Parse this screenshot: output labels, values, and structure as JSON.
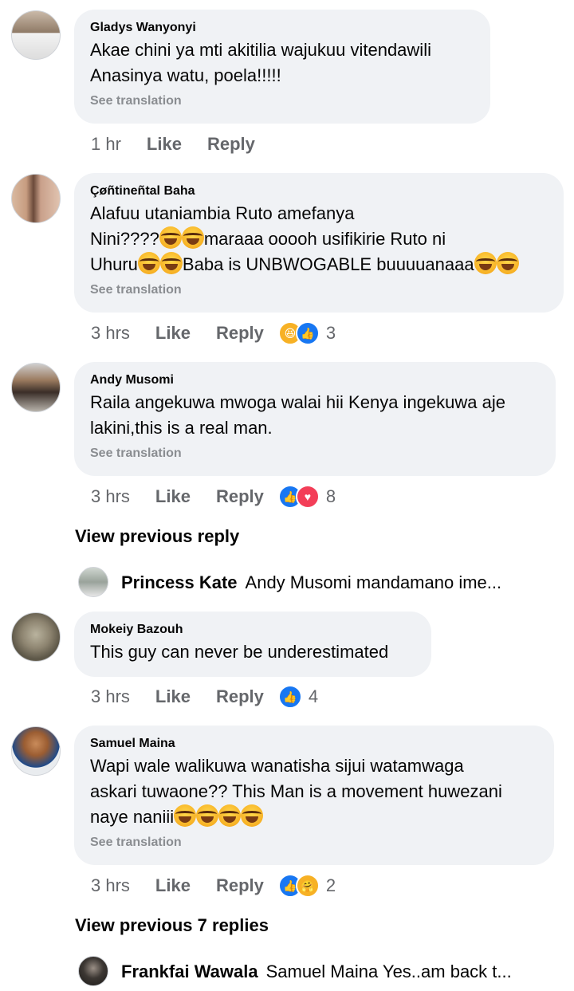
{
  "comments": [
    {
      "name": "Gladys Wanyonyi",
      "lines": [
        "Akae chini ya mti akitilia wajukuu vitendawili",
        "Anasinya watu, poela!!!!!"
      ],
      "see_translation": "See translation",
      "time": "1 hr",
      "like": "Like",
      "reply": "Reply"
    },
    {
      "name": "Çøñtineñtal Baha",
      "line1": "Alafuu utaniambia Ruto amefanya",
      "line2a": "Nini????",
      "line2b": "maraaa ooooh usifikirie Ruto ni",
      "line3a": "Uhuru",
      "line3b": "Baba is UNBWOGABLE buuuuanaaa",
      "see_translation": "See translation",
      "time": "3 hrs",
      "like": "Like",
      "reply": "Reply",
      "reaction_count": "3",
      "reactions": [
        "haha-icon",
        "like-icon"
      ]
    },
    {
      "name": "Andy Musomi",
      "lines": [
        "Raila angekuwa mwoga walai hii Kenya ingekuwa aje",
        "lakini,this is a real man."
      ],
      "see_translation": "See translation",
      "time": "3 hrs",
      "like": "Like",
      "reply": "Reply",
      "reaction_count": "8",
      "reactions": [
        "like-icon",
        "love-icon"
      ]
    },
    {
      "name": "Mokeiy Bazouh",
      "lines": [
        "This guy can never be underestimated"
      ],
      "time": "3 hrs",
      "like": "Like",
      "reply": "Reply",
      "reaction_count": "4",
      "reactions": [
        "like-icon"
      ]
    },
    {
      "name": "Samuel Maina",
      "line1": "Wapi wale walikuwa wanatisha sijui watamwaga",
      "line2": "askari tuwaone?? This Man is a movement huwezani",
      "line3": "naye naniii",
      "see_translation": "See translation",
      "time": "3 hrs",
      "like": "Like",
      "reply": "Reply",
      "reaction_count": "2",
      "reactions": [
        "like-icon",
        "care-icon"
      ]
    }
  ],
  "view_prev_1": "View previous reply",
  "reply_preview_1": {
    "name": "Princess Kate",
    "text": "Andy Musomi mandamano ime..."
  },
  "view_prev_2": "View previous 7 replies",
  "reply_preview_2": {
    "name": "Frankfai Wawala",
    "text": "Samuel Maina Yes..am back t..."
  },
  "colors": {
    "bubble": "#f0f2f5",
    "meta": "#65676b",
    "like_blue": "#1877f2",
    "love_red": "#f33e58",
    "haha_yellow": "#f7b125"
  }
}
